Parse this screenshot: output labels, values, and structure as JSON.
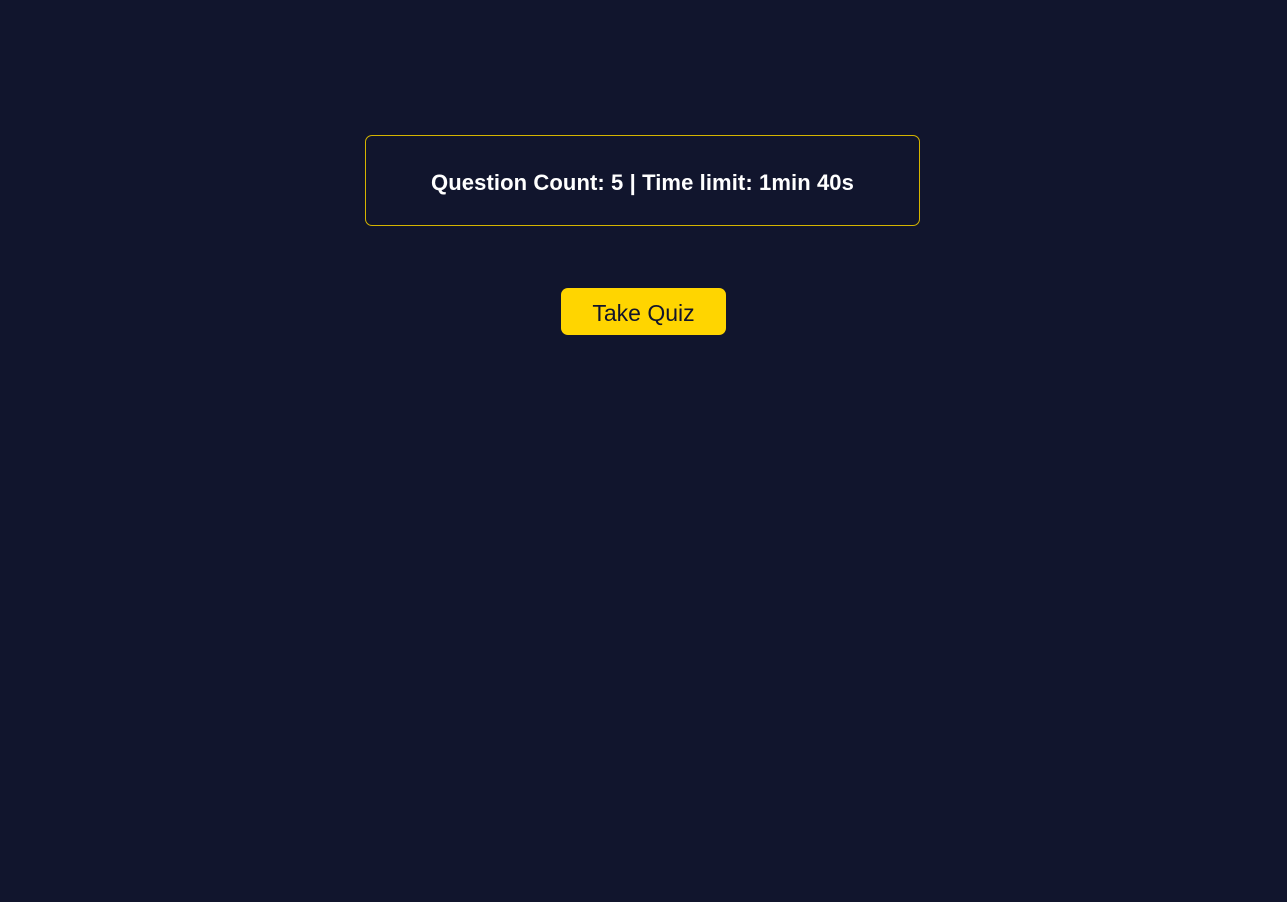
{
  "quiz_info": {
    "text": "Question Count: 5 | Time limit: 1min 40s"
  },
  "actions": {
    "take_quiz_label": "Take Quiz"
  },
  "colors": {
    "background": "#11152d",
    "accent": "#ffd500",
    "text": "#ffffff"
  }
}
